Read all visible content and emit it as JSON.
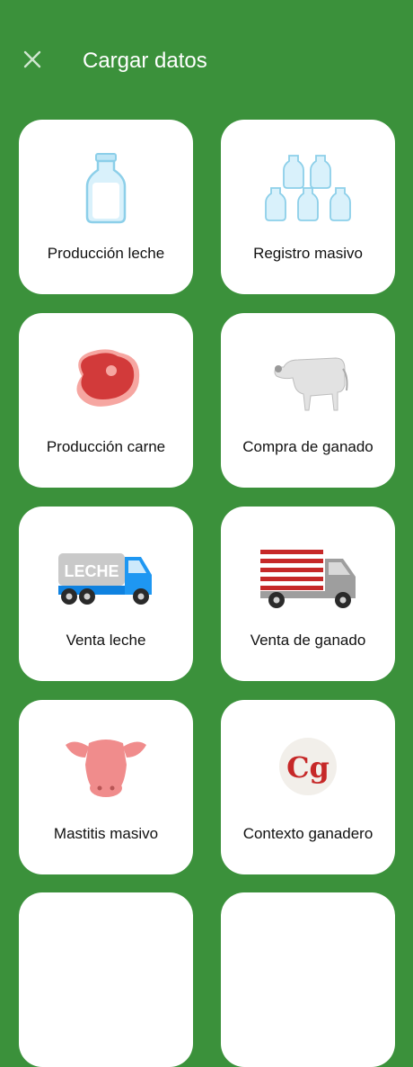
{
  "header": {
    "title": "Cargar datos",
    "close_icon": "close-icon"
  },
  "colors": {
    "background": "#3b913b",
    "card": "#ffffff"
  },
  "cards": [
    {
      "label": "Producción leche",
      "icon": "milk-bottle-icon"
    },
    {
      "label": "Registro masivo",
      "icon": "milk-bottles-icon"
    },
    {
      "label": "Producción carne",
      "icon": "meat-steak-icon"
    },
    {
      "label": "Compra de ganado",
      "icon": "cow-icon"
    },
    {
      "label": "Venta leche",
      "icon": "milk-truck-icon",
      "truck_text": "LECHE"
    },
    {
      "label": "Venta de ganado",
      "icon": "cattle-truck-icon"
    },
    {
      "label": "Mastitis masivo",
      "icon": "cow-head-icon"
    },
    {
      "label": "Contexto ganadero",
      "icon": "cg-logo-icon",
      "logo_text": "Cg"
    }
  ]
}
